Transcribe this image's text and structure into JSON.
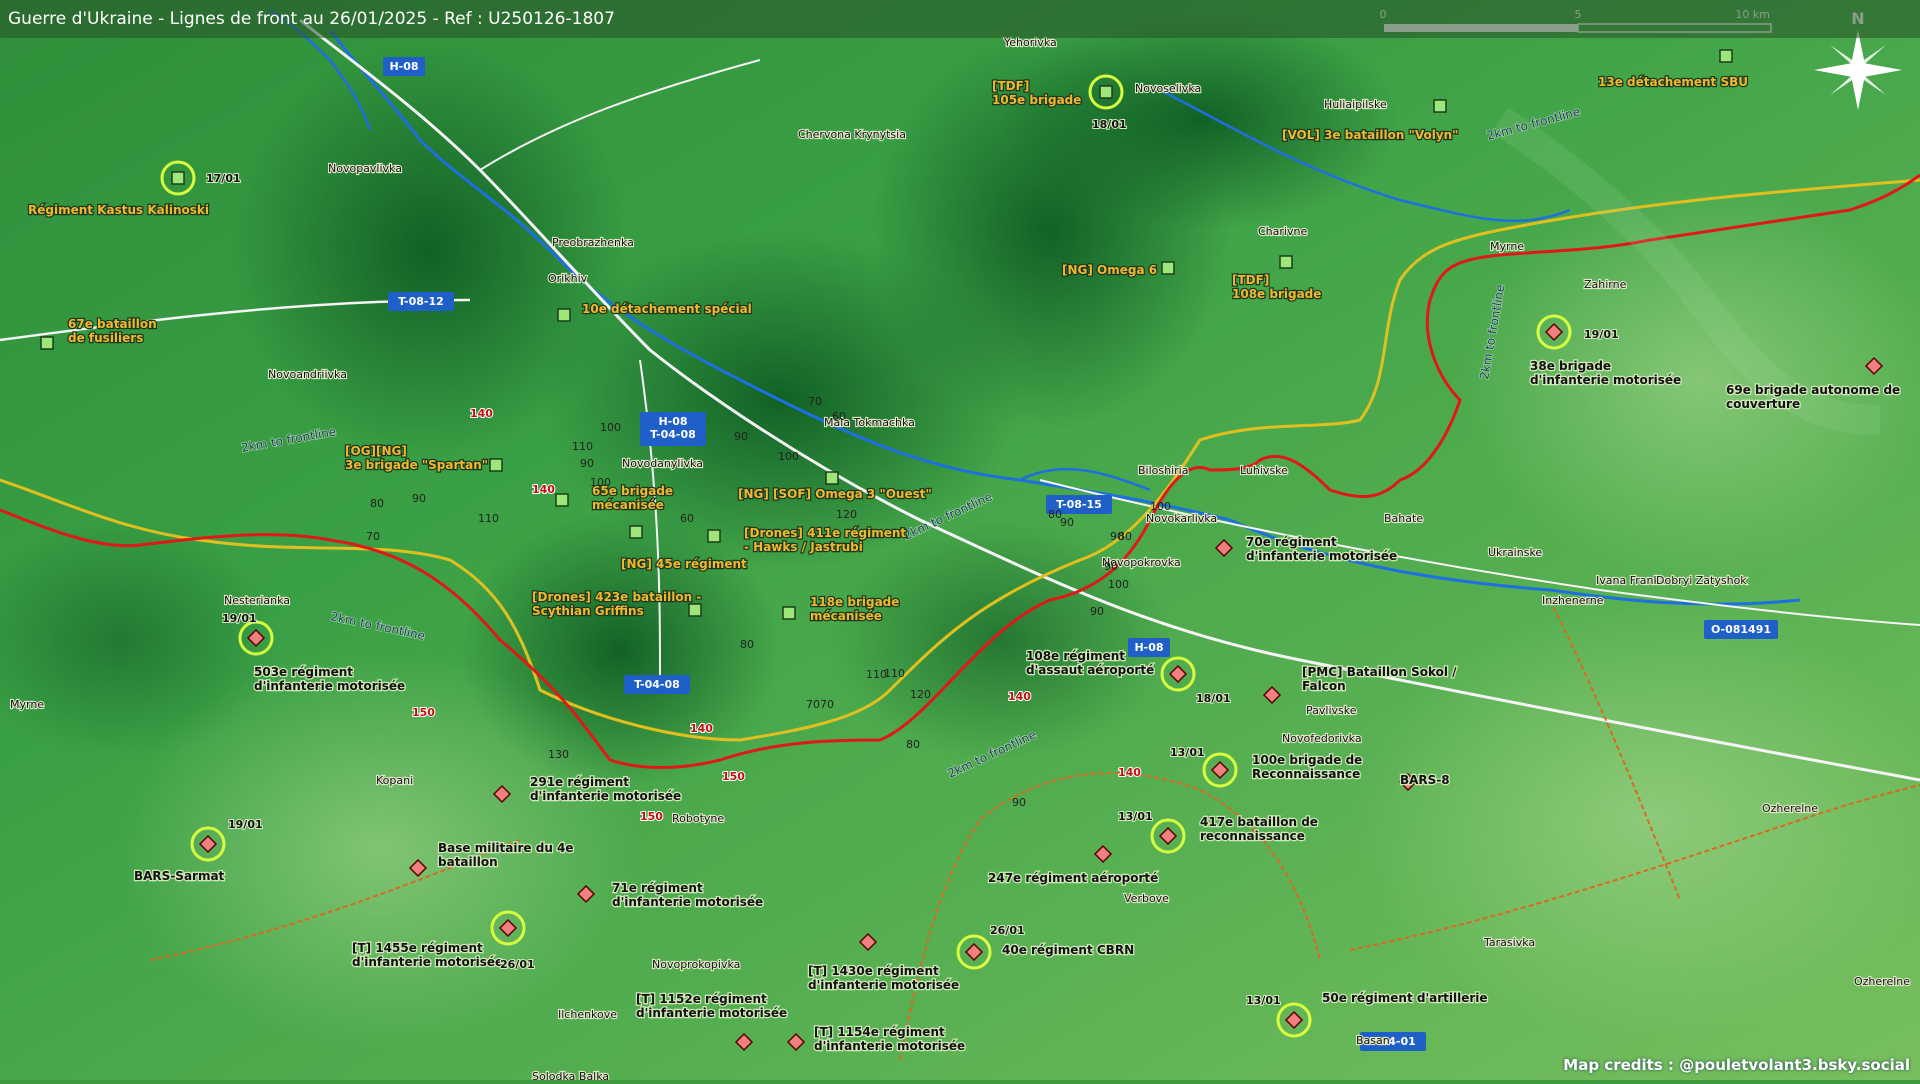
{
  "title": "Guerre d'Ukraine - Lignes de front au 26/01/2025 - Ref : U250126-1807",
  "credits": "Map credits : @pouletvolant3.bsky.social",
  "colors": {
    "frontline_red": "#e01818",
    "frontline_yellow": "#e0c020",
    "river": "#1e6fe0",
    "ua_units": "#f0b830",
    "ru_units": "#111111",
    "road_badge": "#1f5fc8",
    "unit_ring": "#d8ff40"
  },
  "scale": {
    "zero": "0",
    "mid": "5",
    "end": "10 km"
  },
  "north": "N",
  "roads": [
    {
      "id": "h08-top",
      "label": "H-08"
    },
    {
      "id": "t0812",
      "label": "T-08-12"
    },
    {
      "id": "h08-t0408",
      "label": "H-08\nT-04-08"
    },
    {
      "id": "t0815",
      "label": "T-08-15"
    },
    {
      "id": "h08-mid",
      "label": "H-08"
    },
    {
      "id": "t0408",
      "label": "T-04-08"
    },
    {
      "id": "o081491",
      "label": "O-081491"
    },
    {
      "id": "t0401",
      "label": "T-04-01"
    }
  ],
  "settlements": [
    "Yehorivka",
    "Novoselivka",
    "Huliaipilske",
    "Novopavlivka",
    "Chervona Krynytsia",
    "Preobrazhenka",
    "Orikhiv",
    "Charivne",
    "Myrne",
    "Zahirne",
    "Novoandriivka",
    "Mala Tokmachka",
    "Novodanylivka",
    "Biloshiria",
    "Luhivske",
    "Novokarlivka",
    "Bahate",
    "Novopokrovka",
    "Ukrainske",
    "Ivana Franka",
    "Dobryi Zatyshok",
    "Inzhenerne",
    "Nesterianka",
    "Myrne",
    "Pavlivske",
    "Novofedorivka",
    "Kopani",
    "Robotyne",
    "Ozherelne",
    "Verbove",
    "Tarasivka",
    "Novoprokopivka",
    "Ilchenkove",
    "Solodka Balka",
    "Basan",
    "Ozherelne"
  ],
  "distance_notes": [
    "2km to frontline",
    "2km to frontline",
    "2km to frontline",
    "2km to frontline",
    "2km to frontline",
    "2km to frontline"
  ],
  "elevations": [
    "140",
    "140",
    "140",
    "150",
    "150",
    "140",
    "100",
    "110",
    "90",
    "100",
    "80",
    "90",
    "110",
    "90",
    "100",
    "80",
    "90",
    "110",
    "70",
    "80",
    "60",
    "70",
    "120",
    "100",
    "90",
    "110",
    "120",
    "130",
    "140",
    "150",
    "70",
    "70",
    "60",
    "90",
    "100",
    "80",
    "90",
    "90",
    "80"
  ],
  "ua_units": [
    "Régiment Kastus Kalinoski",
    "67e bataillon\nde fusiliers",
    "10e détachement spécial",
    "[OG][NG]\n3e brigade \"Spartan\"",
    "65e brigade\nmécanisée",
    "[NG] [SOF] Omega 3 \"Ouest\"",
    "[Drones] 411e régiment\n- Hawks / Jastrubi",
    "[NG] 45e régiment",
    "[Drones] 423e bataillon -\nScythian Griffins",
    "118e brigade\nmécanisée",
    "[TDF]\n105e brigade",
    "[VOL] 3e bataillon \"Volyn\"",
    "13e détachement SBU",
    "[NG] Omega 6",
    "[TDF]\n108e brigade"
  ],
  "ru_units": [
    "38e brigade\nd'infanterie motorisée",
    "69e brigade autonome de\ncouverture",
    "70e régiment\nd'infanterie motorisée",
    "108e régiment\nd'assaut aéroporté",
    "[PMC] Bataillon Sokol /\nFalcon",
    "100e brigade de\nReconnaissance",
    "BARS-8",
    "417e bataillon de\nreconnaissance",
    "247e régiment aéroporté",
    "40e régiment CBRN",
    "50e régiment d'artillerie",
    "503e régiment\nd'infanterie motorisée",
    "291e régiment\nd'infanterie motorisée",
    "BARS-Sarmat",
    "Base militaire du 4e\nbataillon",
    "71e régiment\nd'infanterie motorisée",
    "[T] 1455e régiment\nd'infanterie motorisée",
    "[T] 1430e régiment\nd'infanterie motorisée",
    "[T] 1152e régiment\nd'infanterie motorisée",
    "[T] 1154e régiment\nd'infanterie motorisée"
  ],
  "dates": [
    "17/01",
    "18/01",
    "19/01",
    "19/01",
    "18/01",
    "13/01",
    "13/01",
    "19/01",
    "26/01",
    "26/01",
    "13/01"
  ]
}
